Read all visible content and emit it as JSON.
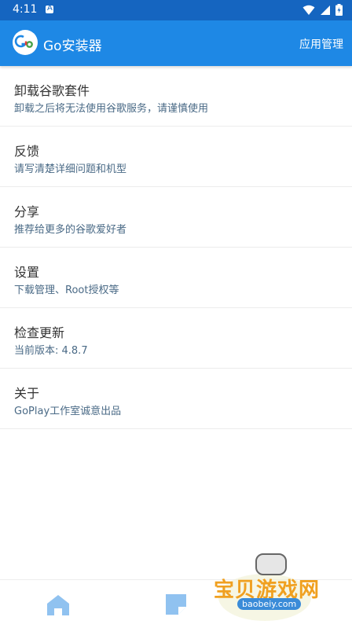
{
  "status": {
    "time": "4:11"
  },
  "header": {
    "title": "Go安装器",
    "action": "应用管理"
  },
  "items": [
    {
      "title": "卸载谷歌套件",
      "subtitle": "卸载之后将无法使用谷歌服务，请谨慎使用"
    },
    {
      "title": "反馈",
      "subtitle": "请写清楚详细问题和机型"
    },
    {
      "title": "分享",
      "subtitle": "推荐给更多的谷歌爱好者"
    },
    {
      "title": "设置",
      "subtitle": "下载管理、Root授权等"
    },
    {
      "title": "检查更新",
      "subtitle": "当前版本: 4.8.7"
    },
    {
      "title": "关于",
      "subtitle": "GoPlay工作室诚意出品"
    }
  ],
  "watermark": {
    "title": "宝贝游戏网",
    "url": "baobeiy.com"
  }
}
